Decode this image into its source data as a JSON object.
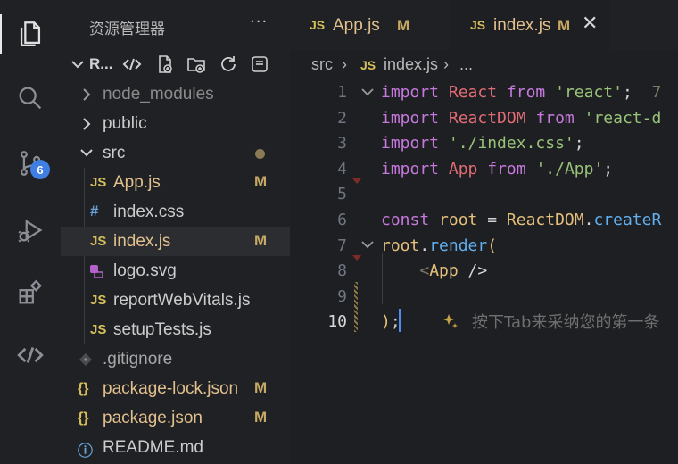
{
  "activity_bar": {
    "items": [
      "explorer-icon",
      "search-icon",
      "source-control-icon",
      "run-debug-icon",
      "extensions-icon",
      "remote-icon"
    ],
    "source_control_badge": "6"
  },
  "sidebar": {
    "title": "资源管理器",
    "more": "···",
    "root": "R...",
    "toolbar": [
      "remote-icon",
      "new-file-icon",
      "new-folder-icon",
      "refresh-icon",
      "collapse-all-icon"
    ],
    "tree": [
      {
        "label": "node_modules",
        "type": "folder",
        "status": ""
      },
      {
        "label": "public",
        "type": "folder",
        "status": ""
      },
      {
        "label": "src",
        "type": "folder-open",
        "status": ""
      },
      {
        "label": "App.js",
        "type": "js",
        "status": "M"
      },
      {
        "label": "index.css",
        "type": "css",
        "status": ""
      },
      {
        "label": "index.js",
        "type": "js",
        "status": "M"
      },
      {
        "label": "logo.svg",
        "type": "svg",
        "status": ""
      },
      {
        "label": "reportWebVitals.js",
        "type": "js",
        "status": ""
      },
      {
        "label": "setupTests.js",
        "type": "js",
        "status": ""
      },
      {
        "label": ".gitignore",
        "type": "git",
        "status": ""
      },
      {
        "label": "package-lock.json",
        "type": "json",
        "status": "M"
      },
      {
        "label": "package.json",
        "type": "json",
        "status": "M"
      },
      {
        "label": "README.md",
        "type": "info",
        "status": ""
      }
    ],
    "icon_text": {
      "js": "JS",
      "css": "#",
      "json": "{}",
      "info": "ⓘ"
    }
  },
  "tabs": [
    {
      "name": "App.js",
      "status": "M",
      "icon": "JS"
    },
    {
      "name": "index.js",
      "status": "M",
      "icon": "JS",
      "close": "✕"
    }
  ],
  "breadcrumb": {
    "folder": "src",
    "sep": "›",
    "icon": "JS",
    "file": "index.js",
    "more": "..."
  },
  "editor": {
    "line_numbers": [
      "1",
      "2",
      "3",
      "4",
      "5",
      "6",
      "7",
      "8",
      "9",
      "10"
    ],
    "lines": [
      [
        {
          "t": "import",
          "c": "k"
        },
        {
          "t": " "
        },
        {
          "t": "React",
          "c": "v"
        },
        {
          "t": " "
        },
        {
          "t": "from",
          "c": "k"
        },
        {
          "t": " "
        },
        {
          "t": "'react'",
          "c": "s"
        },
        {
          "t": ";  "
        },
        {
          "t": "7",
          "c": "dim"
        }
      ],
      [
        {
          "t": "import",
          "c": "k"
        },
        {
          "t": " "
        },
        {
          "t": "ReactDOM",
          "c": "v"
        },
        {
          "t": " "
        },
        {
          "t": "from",
          "c": "k"
        },
        {
          "t": " "
        },
        {
          "t": "'react-d",
          "c": "s"
        }
      ],
      [
        {
          "t": "import",
          "c": "k"
        },
        {
          "t": " "
        },
        {
          "t": "'./index.css'",
          "c": "s"
        },
        {
          "t": ";"
        }
      ],
      [
        {
          "t": "import",
          "c": "k"
        },
        {
          "t": " "
        },
        {
          "t": "App",
          "c": "v"
        },
        {
          "t": " "
        },
        {
          "t": "from",
          "c": "k"
        },
        {
          "t": " "
        },
        {
          "t": "'./App'",
          "c": "s"
        },
        {
          "t": ";"
        }
      ],
      [],
      [
        {
          "t": "const",
          "c": "k"
        },
        {
          "t": " "
        },
        {
          "t": "root",
          "c": "p"
        },
        {
          "t": " = "
        },
        {
          "t": "ReactDOM",
          "c": "p"
        },
        {
          "t": "."
        },
        {
          "t": "createR",
          "c": "f"
        }
      ],
      [
        {
          "t": "root",
          "c": "p"
        },
        {
          "t": "."
        },
        {
          "t": "render",
          "c": "f"
        },
        {
          "t": "(",
          "c": "p"
        }
      ],
      [
        {
          "t": "    "
        },
        {
          "t": "<",
          "c": "dim"
        },
        {
          "t": "App",
          "c": "p"
        },
        {
          "t": " />"
        }
      ],
      [],
      [
        {
          "t": ")",
          "c": "p"
        },
        {
          "t": ";"
        }
      ]
    ],
    "ghost_icon": "sparkle-icon",
    "ghost_text": "按下Tab来采纳您的第一条"
  },
  "colors": {
    "accent": "#3f7ee3",
    "modified": "#c7a865",
    "js_icon": "#d7c05a"
  }
}
